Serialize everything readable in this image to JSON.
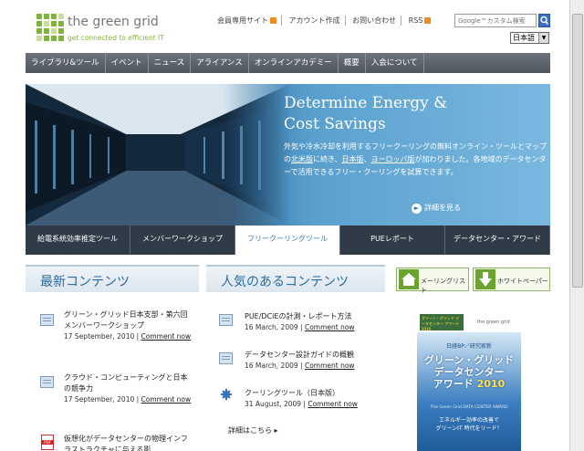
{
  "header": {
    "logo_name": "the green grid",
    "logo_tagline": "get connected to efficient IT",
    "links": [
      "会員専用サイト",
      "アカウント作成",
      "お問い合わせ",
      "RSS"
    ],
    "search_placeholder": "Google™カスタム検索",
    "language": "日本語"
  },
  "nav": {
    "items": [
      "ライブラリ&ツール",
      "イベント",
      "ニュース",
      "アライアンス",
      "オンラインアカデミー",
      "概要",
      "入会について"
    ]
  },
  "hero": {
    "title_line1": "Determine Energy &",
    "title_line2": "Cost Savings",
    "text_part1": "外気や冷水冷却を利用するフリークーリングの無料オンライン・ツールとマップの",
    "link1": "北米版",
    "text_part2": "に続き、",
    "link2": "日本版",
    "text_part3": "、",
    "link3": "ヨーロッパ版",
    "text_part4": "が加わりました。各地域のデータセンターで活用できるフリー・クーリングを試算できます。",
    "more_label": "詳細を見る"
  },
  "tabs": [
    "給電系統効率推定ツール",
    "メンバーワークショップ",
    "フリークーリングツール",
    "PUEレポート",
    "データセンター・アワード"
  ],
  "latest": {
    "heading": "最新コンテンツ",
    "items": [
      {
        "title": "グリーン・グリッド日本支部・第六回メンバーワークショップ",
        "date": "17 September, 2010",
        "comment": "Comment now"
      },
      {
        "title": "クラウド・コンピューティングと日本の競争力",
        "date": "17 September, 2010",
        "comment": "Comment now"
      },
      {
        "title": "仮想化がデータセンターの物理インフラストラクチャに与える影",
        "date": "",
        "comment": ""
      }
    ]
  },
  "popular": {
    "heading": "人気のあるコンテンツ",
    "items": [
      {
        "title": "PUE/DCiEの計測・レポート方法",
        "date": "16 March, 2009",
        "comment": "Comment now"
      },
      {
        "title": "データセンター設計ガイドの概観",
        "date": "16 March, 2009",
        "comment": "Comment now"
      },
      {
        "title": "クーリングツール（日本版）",
        "date": "31 August, 2009",
        "comment": "Comment now"
      }
    ],
    "details_label": "詳細はこちら"
  },
  "buttons": {
    "mailing_list": "メーリングリスト",
    "white_paper": "ホワイトペーパー"
  },
  "award": {
    "badge_text": "グリーン・グリッド データセンター アワード 2010",
    "logo_text": "the green grid",
    "subtitle": "日経BP／研究家新",
    "title_line1": "グリーン・グリッド",
    "title_line2": "データセンター",
    "title_line3": "アワード",
    "year": "2010",
    "english": "The Green Grid DATA CENTER AWARD",
    "tagline_line1": "エネルギー効率の改善で",
    "tagline_line2": "グリーンIT 時代をリード！"
  }
}
